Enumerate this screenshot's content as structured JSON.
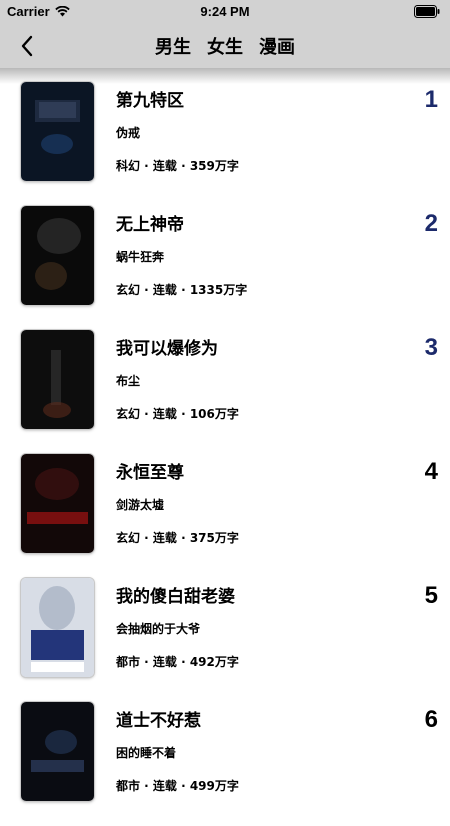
{
  "status_bar": {
    "carrier": "Carrier",
    "time": "9:24 PM"
  },
  "nav": {
    "tabs": [
      {
        "label": "男生"
      },
      {
        "label": "女生"
      },
      {
        "label": "漫画"
      }
    ]
  },
  "books": [
    {
      "title": "第九特区",
      "author": "伪戒",
      "meta": "科幻 · 连载 · 359万字",
      "rank": "1",
      "cover_color": "#0b1524"
    },
    {
      "title": "无上神帝",
      "author": "蜗牛狂奔",
      "meta": "玄幻 · 连载 · 1335万字",
      "rank": "2",
      "cover_color": "#0a0a0a"
    },
    {
      "title": "我可以爆修为",
      "author": "布尘",
      "meta": "玄幻 · 连载 · 106万字",
      "rank": "3",
      "cover_color": "#0d0d0d"
    },
    {
      "title": "永恒至尊",
      "author": "剑游太墟",
      "meta": "玄幻 · 连载 · 375万字",
      "rank": "4",
      "cover_color": "#120808"
    },
    {
      "title": "我的傻白甜老婆",
      "author": "会抽烟的于大爷",
      "meta": "都市 · 连载 · 492万字",
      "rank": "5",
      "cover_color": "#d8dde6"
    },
    {
      "title": "道士不好惹",
      "author": "困的睡不着",
      "meta": "都市 · 连载 · 499万字",
      "rank": "6",
      "cover_color": "#0a0c12"
    }
  ]
}
